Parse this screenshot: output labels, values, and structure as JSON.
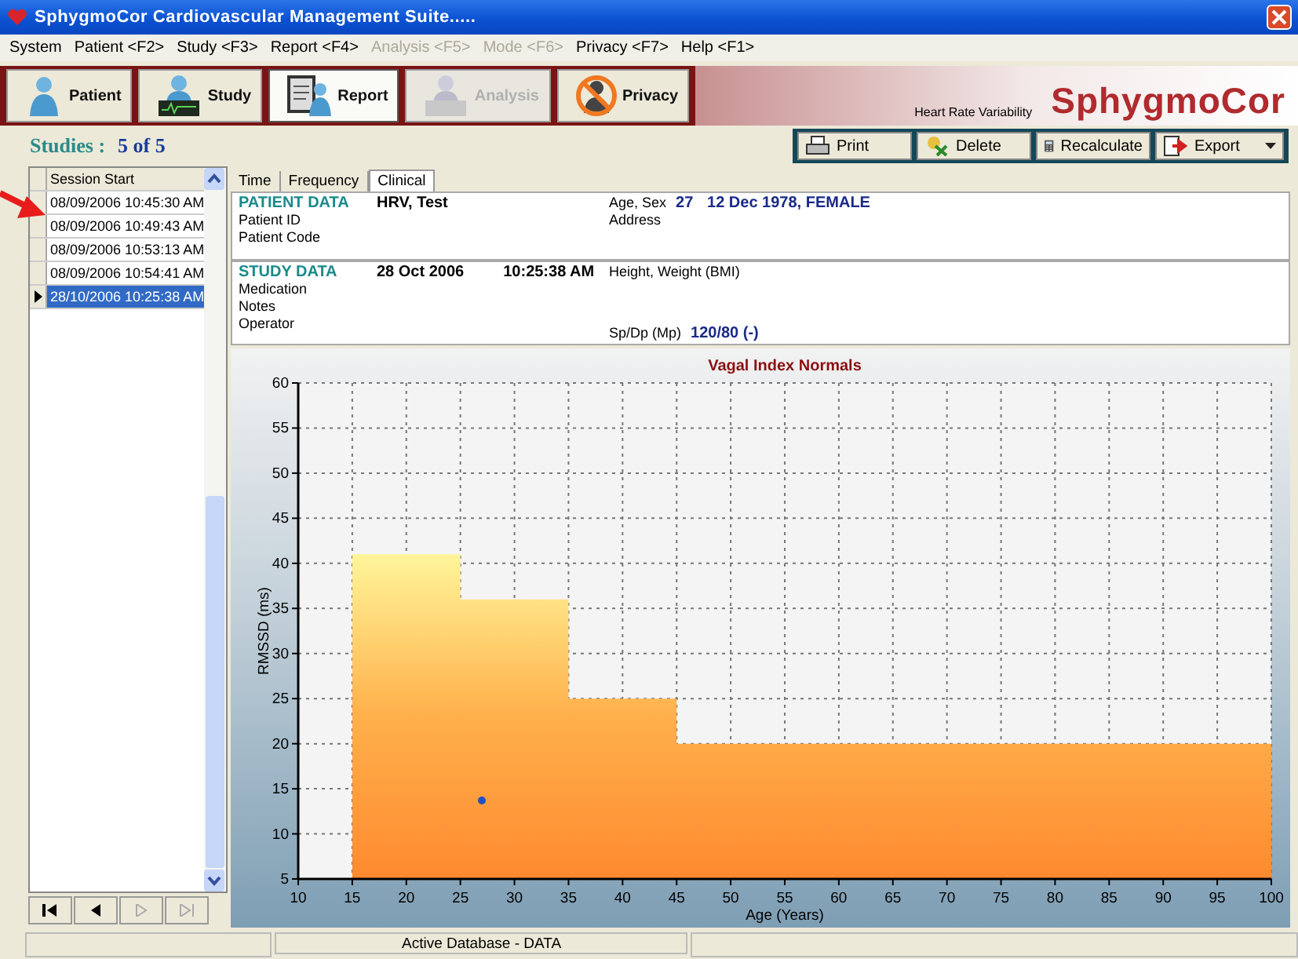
{
  "window": {
    "title": "SphygmoCor Cardiovascular Management Suite....."
  },
  "menu": [
    {
      "label": "System",
      "disabled": false
    },
    {
      "label": "Patient <F2>",
      "disabled": false
    },
    {
      "label": "Study <F3>",
      "disabled": false
    },
    {
      "label": "Report <F4>",
      "disabled": false
    },
    {
      "label": "Analysis <F5>",
      "disabled": true
    },
    {
      "label": "Mode <F6>",
      "disabled": true
    },
    {
      "label": "Privacy <F7>",
      "disabled": false
    },
    {
      "label": "Help <F1>",
      "disabled": false
    }
  ],
  "toolbar": {
    "buttons": [
      {
        "label": "Patient",
        "kind": "patient",
        "selected": false,
        "disabled": false
      },
      {
        "label": "Study",
        "kind": "study",
        "selected": false,
        "disabled": false
      },
      {
        "label": "Report",
        "kind": "report",
        "selected": true,
        "disabled": false
      },
      {
        "label": "Analysis",
        "kind": "analysis",
        "selected": false,
        "disabled": true
      },
      {
        "label": "Privacy",
        "kind": "privacy",
        "selected": false,
        "disabled": false
      }
    ],
    "subtitle": "Heart Rate Variability",
    "logo": "SphygmoCor"
  },
  "studies": {
    "label": "Studies :",
    "count": "5 of 5"
  },
  "actions": [
    {
      "label": "Print",
      "kind": "print"
    },
    {
      "label": "Delete",
      "kind": "delete"
    },
    {
      "label": "Recalculate",
      "kind": "calc"
    },
    {
      "label": "Export",
      "kind": "export"
    }
  ],
  "sessions": {
    "column": "Session Start",
    "rows": [
      {
        "text": "08/09/2006 10:45:30 AM",
        "selected": false
      },
      {
        "text": "08/09/2006 10:49:43 AM",
        "selected": false
      },
      {
        "text": "08/09/2006 10:53:13 AM",
        "selected": false
      },
      {
        "text": "08/09/2006 10:54:41 AM",
        "selected": false
      },
      {
        "text": "28/10/2006 10:25:38 AM",
        "selected": true
      }
    ]
  },
  "navigator": [
    {
      "kind": "first",
      "disabled": false
    },
    {
      "kind": "prev",
      "disabled": false
    },
    {
      "kind": "next",
      "disabled": true
    },
    {
      "kind": "last",
      "disabled": true
    }
  ],
  "tabs": [
    {
      "label": "Time",
      "selected": false
    },
    {
      "label": "Frequency",
      "selected": false
    },
    {
      "label": "Clinical",
      "selected": true
    }
  ],
  "patient": {
    "heading": "PATIENT DATA",
    "name": "HRV, Test",
    "labels": [
      "Patient ID",
      "Patient Code"
    ],
    "age_sex_label": "Age, Sex",
    "age": "27",
    "dob_sex": "12 Dec 1978, FEMALE",
    "address_label": "Address"
  },
  "study": {
    "heading": "STUDY DATA",
    "date": "28 Oct 2006",
    "time": "10:25:38 AM",
    "labels": [
      "Medication",
      "Notes",
      "Operator"
    ],
    "height_weight_label": "Height, Weight (BMI)",
    "bp_label": "Sp/Dp (Mp)",
    "bp": "120/80 (-)"
  },
  "chart": {
    "chart_data": {
      "type": "area",
      "title": "Vagal Index Normals",
      "xlabel": "Age (Years)",
      "ylabel": "RMSSD (ms)",
      "x": [
        15,
        25,
        25,
        35,
        35,
        45,
        45,
        100
      ],
      "series": [
        {
          "color": "#ffb04a",
          "values": [
            41,
            41,
            36,
            36,
            25,
            25,
            20,
            20
          ]
        }
      ],
      "grid": true,
      "xlim": [
        10,
        100
      ],
      "ylim": [
        5,
        60
      ],
      "xticks": [
        10,
        15,
        20,
        25,
        30,
        35,
        40,
        45,
        50,
        55,
        60,
        65,
        70,
        75,
        80,
        85,
        90,
        95,
        100
      ],
      "yticks": [
        5,
        10,
        15,
        20,
        25,
        30,
        35,
        40,
        45,
        50,
        55,
        60
      ]
    }
  },
  "status_bar": {
    "database": "Active Database - DATA"
  }
}
